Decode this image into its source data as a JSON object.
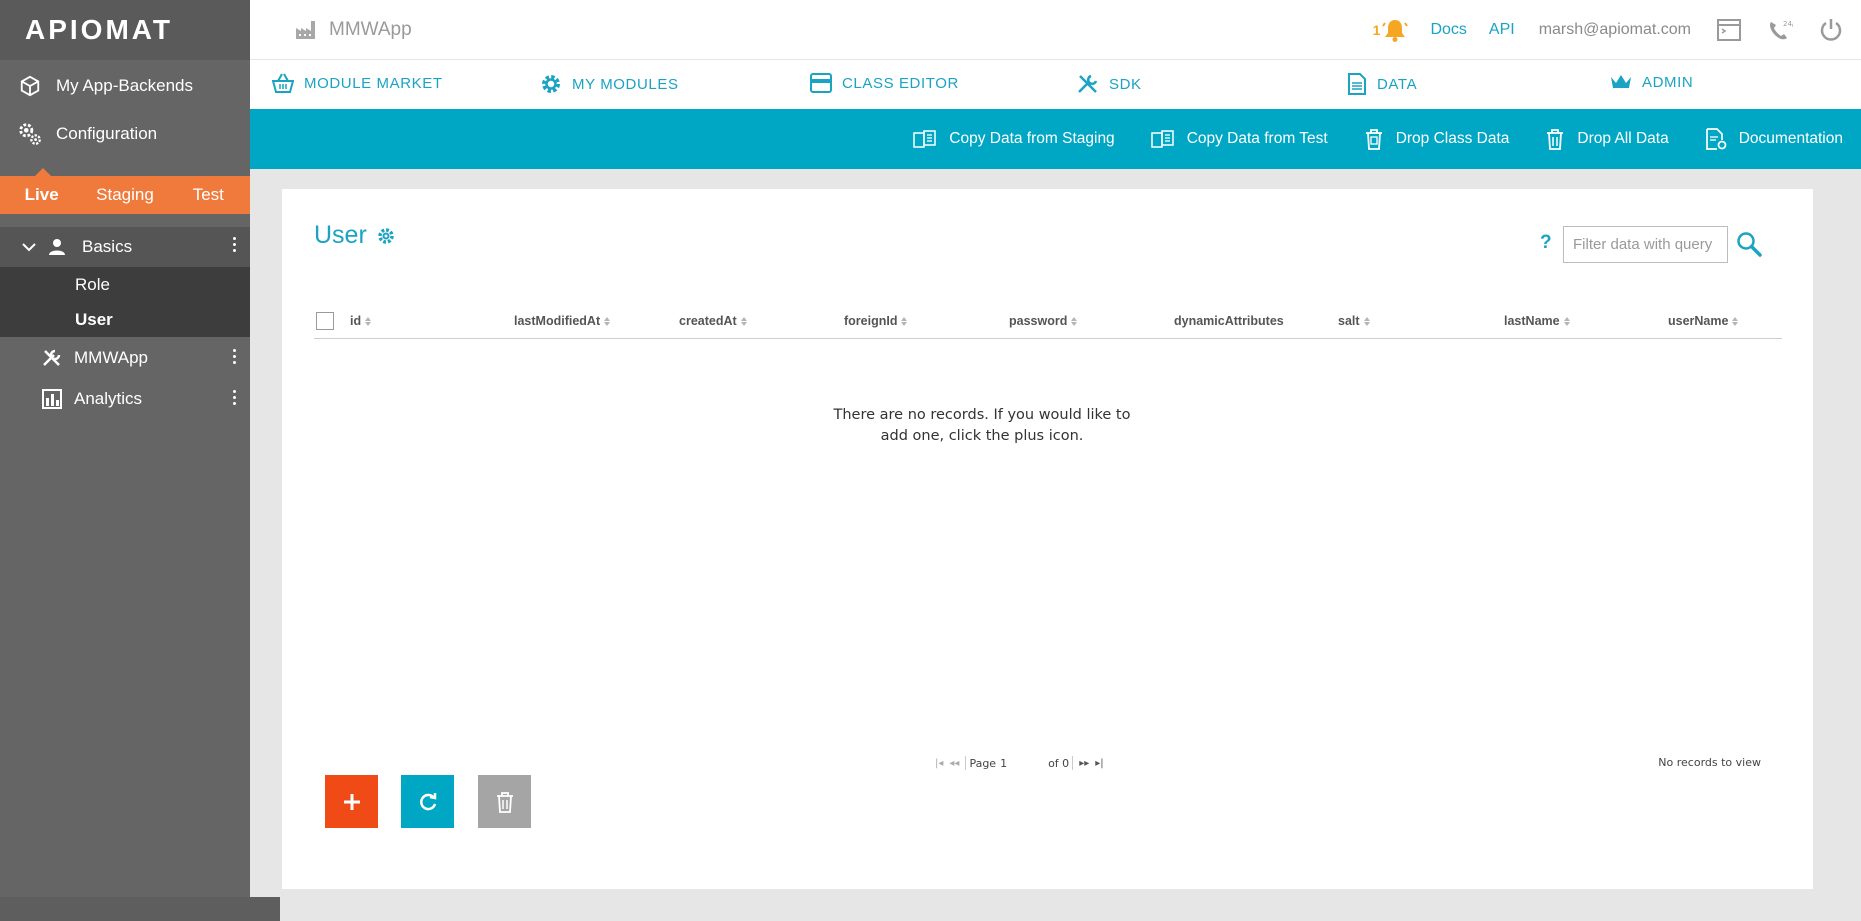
{
  "sidebar": {
    "logo": "APIOMAT",
    "nav": [
      {
        "label": "My App-Backends",
        "icon": "cube-icon"
      },
      {
        "label": "Configuration",
        "icon": "gears-icon"
      }
    ],
    "env_tabs": [
      "Live",
      "Staging",
      "Test"
    ],
    "active_env": "Live",
    "groups": {
      "basics": {
        "label": "Basics",
        "children": [
          "Role",
          "User"
        ],
        "active_child": "User"
      },
      "mmwapp": {
        "label": "MMWApp"
      },
      "analytics": {
        "label": "Analytics"
      }
    }
  },
  "topbar": {
    "app_name": "MMWApp",
    "notification_count": "1",
    "docs": "Docs",
    "api": "API",
    "email": "marsh@apiomat.com"
  },
  "modnav": {
    "tabs": [
      "MODULE MARKET",
      "MY MODULES",
      "CLASS EDITOR",
      "SDK",
      "DATA",
      "ADMIN"
    ]
  },
  "actions": {
    "copy_staging": "Copy Data from Staging",
    "copy_test": "Copy Data from Test",
    "drop_class": "Drop Class Data",
    "drop_all": "Drop All Data",
    "documentation": "Documentation"
  },
  "panel": {
    "title": "User",
    "help": "?",
    "filter_placeholder": "Filter data with query",
    "columns": [
      "id",
      "lastModifiedAt",
      "createdAt",
      "foreignId",
      "password",
      "dynamicAttributes",
      "salt",
      "lastName",
      "userName"
    ],
    "empty_message": "There are no records. If you would like to add one, click the plus icon.",
    "pager": {
      "page_label": "Page",
      "page": "1",
      "of_label": "of 0"
    },
    "no_records": "No records to view"
  },
  "colors": {
    "accent": "#00a7c4",
    "live_tab": "#f07a3c",
    "add_button": "#f04a16",
    "sidebar": "#656565"
  }
}
